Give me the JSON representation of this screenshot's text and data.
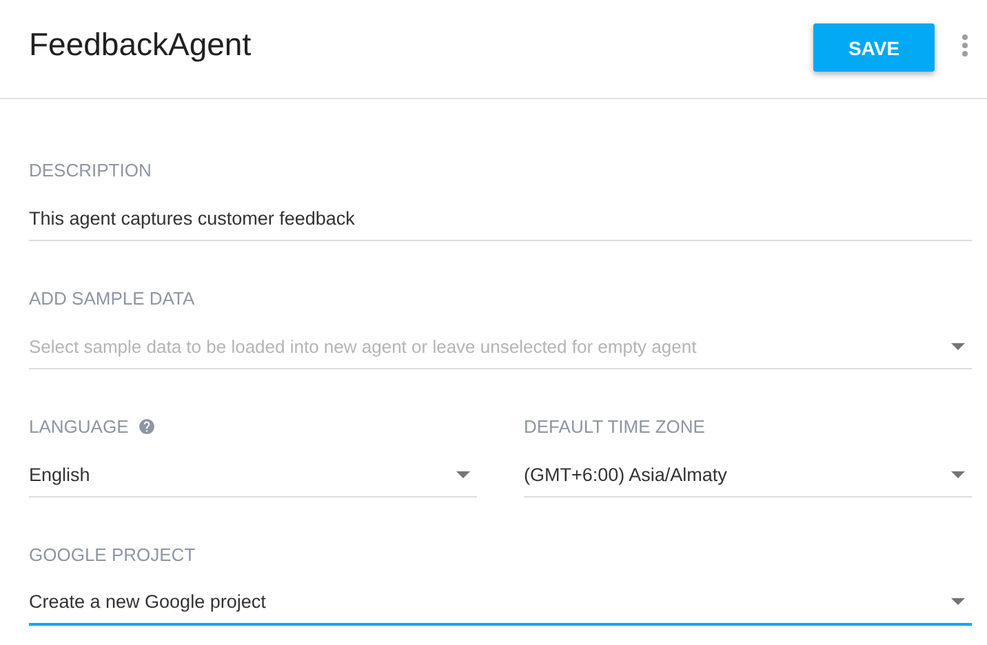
{
  "header": {
    "title": "FeedbackAgent",
    "save_button": "SAVE"
  },
  "rows": [
    [
      {
        "label": "DESCRIPTION",
        "kind": "text",
        "value": "This agent captures customer feedback",
        "focused": false
      }
    ],
    [
      {
        "label": "ADD SAMPLE DATA",
        "kind": "select",
        "placeholder": "Select sample data to be loaded into new agent or leave unselected for empty agent",
        "focused": false
      }
    ],
    [
      {
        "label": "LANGUAGE",
        "kind": "select",
        "value": "English",
        "help": true,
        "focused": false
      },
      {
        "label": "DEFAULT TIME ZONE",
        "kind": "select",
        "value": "(GMT+6:00) Asia/Almaty",
        "focused": false
      }
    ],
    [
      {
        "label": "GOOGLE PROJECT",
        "kind": "select",
        "value": "Create a new Google project",
        "focused": true
      }
    ]
  ]
}
